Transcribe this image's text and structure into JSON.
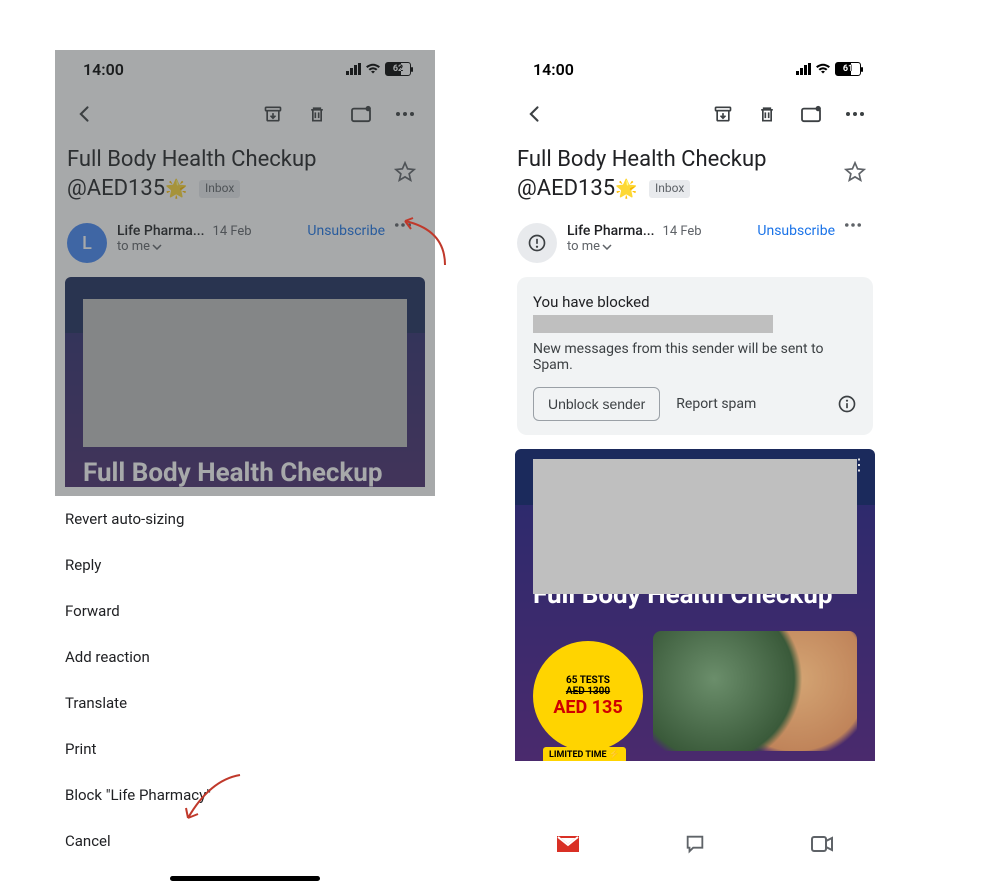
{
  "left": {
    "status": {
      "time": "14:00",
      "battery": "62"
    },
    "subject": "Full Body Health Checkup @AED135",
    "subject_line1": "Full Body Health Checkup",
    "subject_line2": "@AED135",
    "inbox_label": "Inbox",
    "sender": {
      "avatar_letter": "L",
      "name": "Life Pharma...",
      "date": "14 Feb",
      "recipient": "to me",
      "unsubscribe": "Unsubscribe"
    },
    "hero_title": "Full Body Health Checkup",
    "menu": {
      "revert": "Revert auto-sizing",
      "reply": "Reply",
      "forward": "Forward",
      "add_reaction": "Add reaction",
      "translate": "Translate",
      "print": "Print",
      "block": "Block \"Life Pharmacy\"",
      "cancel": "Cancel"
    }
  },
  "right": {
    "status": {
      "time": "14:00",
      "battery": "61"
    },
    "subject_line1": "Full Body Health Checkup",
    "subject_line2": "@AED135",
    "inbox_label": "Inbox",
    "sender": {
      "name": "Life Pharma...",
      "date": "14 Feb",
      "recipient": "to me",
      "unsubscribe": "Unsubscribe"
    },
    "blocked": {
      "title": "You have blocked",
      "desc": "New messages from this sender will be sent to Spam.",
      "unblock": "Unblock sender",
      "report": "Report spam"
    },
    "hero": {
      "title": "Full Body Health Checkup",
      "tests": "65 TESTS",
      "old_price": "AED 1300",
      "new_price": "AED 135",
      "limited": "LIMITED TIME"
    }
  }
}
